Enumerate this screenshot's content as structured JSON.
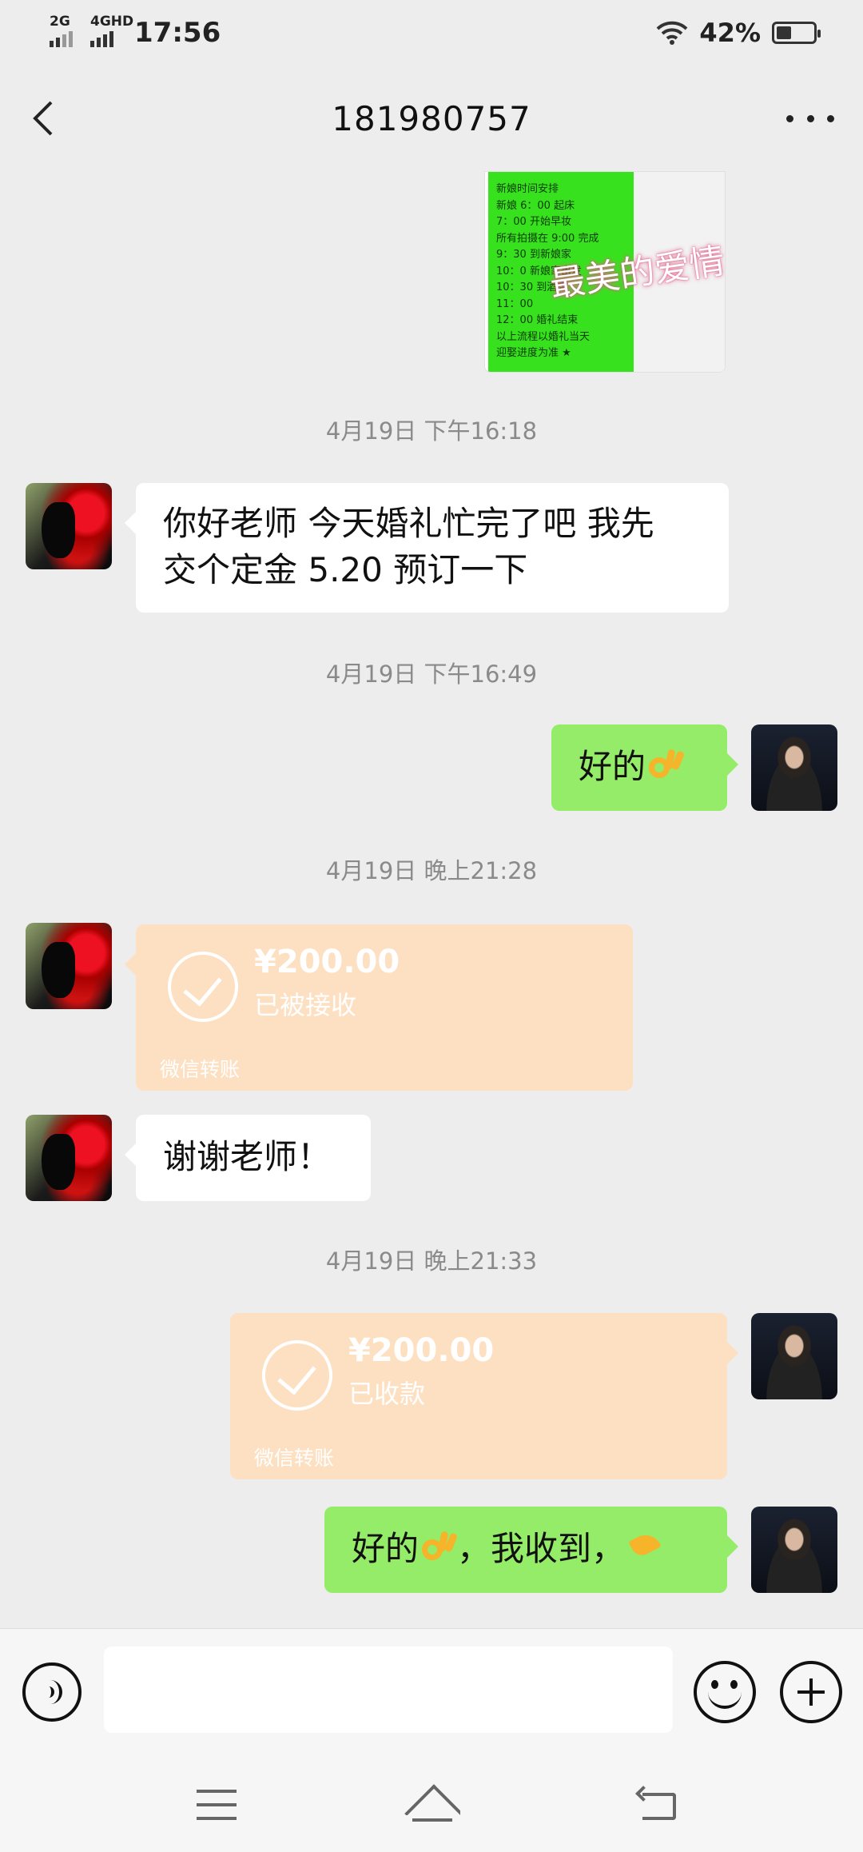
{
  "status_bar": {
    "signal1": "2G",
    "signal2": "4GHD",
    "time": "17:56",
    "battery": "42%",
    "battery_level": 0.42
  },
  "header": {
    "title": "181980757"
  },
  "image_message": {
    "lines": [
      "新娘时间安排",
      "新娘 6：00 起床",
      "7：00 开始早妆",
      "所有拍摄在 9:00 完成",
      "9：30 到新娘家",
      "10：0 新娘家出发",
      "10：30 到酒店",
      "11：00",
      "12：00 婚礼结束",
      "以上流程以婚礼当天",
      "迎娶进度为准 ★"
    ],
    "overlay": "最美的爱情"
  },
  "messages": {
    "ts1": "4月19日 下午16:18",
    "msg1_line1": "你好老师  今天婚礼忙完了吧   我先",
    "msg1_line2": "交个定金   5.20 预订一下",
    "ts2": "4月19日 下午16:49",
    "msg2_text": "好的",
    "ts3": "4月19日 晚上21:28",
    "transfer1": {
      "amount": "¥200.00",
      "state": "已被接收",
      "source": "微信转账"
    },
    "msg3_text": "谢谢老师！",
    "ts4": "4月19日 晚上21:33",
    "transfer2": {
      "amount": "¥200.00",
      "state": "已收款",
      "source": "微信转账"
    },
    "msg4_part1": "好的",
    "msg4_part2": "，我收到，"
  },
  "input": {
    "value": ""
  },
  "icons": {
    "back": "chevron-left-icon",
    "more": "more-dots-icon",
    "voice": "voice-icon",
    "emoji": "smiley-icon",
    "plus": "plus-icon",
    "ok": "ok-hand-emoji",
    "pray": "pray-hands-emoji"
  },
  "colors": {
    "background": "#ededed",
    "bubble_self": "#95ec69",
    "bubble_other": "#ffffff",
    "transfer": "#fde0c2"
  }
}
